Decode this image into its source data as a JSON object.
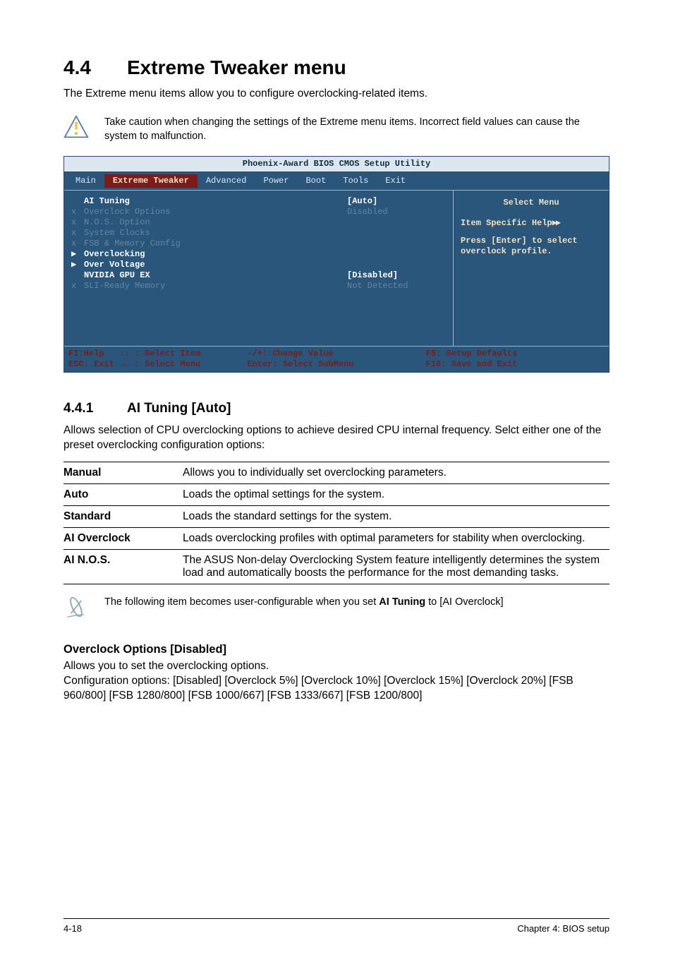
{
  "heading": {
    "num": "4.4",
    "title": "Extreme Tweaker menu"
  },
  "intro": "The Extreme menu items allow you to configure overclocking-related items.",
  "warn": "Take caution when changing the settings of the Extreme menu items. Incorrect field values can cause the system to malfunction.",
  "bios": {
    "title": "Phoenix-Award BIOS CMOS Setup Utility",
    "menu": [
      "Main",
      "Extreme Tweaker",
      "Advanced",
      "Power",
      "Boot",
      "Tools",
      "Exit"
    ],
    "rows": [
      {
        "marker": "",
        "label": "AI Tuning",
        "value": "[Auto]",
        "bright": true
      },
      {
        "marker": "x",
        "label": "Overclock Options",
        "value": "Disabled",
        "dim": true
      },
      {
        "marker": "x",
        "label": "N.O.S. Option",
        "value": "",
        "dim": true
      },
      {
        "marker": "x",
        "label": "System Clocks",
        "value": "",
        "dim": true
      },
      {
        "marker": "x",
        "label": "FSB & Memory Config",
        "value": "",
        "dim": true
      },
      {
        "marker": "▶",
        "label": "Overclocking",
        "value": "",
        "bright": true
      },
      {
        "marker": "▶",
        "label": "Over Voltage",
        "value": "",
        "bright": true
      },
      {
        "marker": "",
        "label": "NVIDIA GPU EX",
        "value": "[Disabled]",
        "bright": true
      },
      {
        "marker": "",
        "label": "",
        "value": ""
      },
      {
        "marker": "x",
        "label": "SLI-Ready Memory",
        "value": "Not Detected",
        "dim": true
      }
    ],
    "help_title": "Select Menu",
    "help_item": "Item Specific Help",
    "help_body1": "Press [Enter] to select",
    "help_body2": "overclock profile.",
    "foot": {
      "l1a": "F1:Help",
      "l1b": "↑↓ : Select Item",
      "l2a": "ESC: Exit",
      "l2b": "→← : Select Menu",
      "c1": "-/+: Change Value",
      "c2": "Enter: Select SubMenu",
      "r1": "F5: Setup Defaults",
      "r2": "F10: Save and Exit"
    }
  },
  "sub": {
    "num": "4.4.1",
    "title": "AI Tuning [Auto]"
  },
  "sub_para": "Allows selection of CPU overclocking options to achieve desired CPU internal frequency. Selct either one of the preset overclocking configuration options:",
  "table": [
    {
      "k": "Manual",
      "v": "Allows you to individually set overclocking parameters."
    },
    {
      "k": "Auto",
      "v": "Loads the optimal settings for the system."
    },
    {
      "k": "Standard",
      "v": "Loads the standard settings for the system."
    },
    {
      "k": "AI Overclock",
      "v": "Loads overclocking profiles with optimal parameters for stability when overclocking."
    },
    {
      "k": "AI N.O.S.",
      "v": "The ASUS Non-delay Overclocking System feature intelligently determines the system load and automatically boosts the performance for the most demanding tasks."
    }
  ],
  "note_pre": "The following item becomes user-configurable when you set ",
  "note_bold": "AI Tuning",
  "note_post": " to [AI Overclock]",
  "sect2_title": "Overclock Options [Disabled]",
  "sect2_line1": "Allows you to set the overclocking options.",
  "sect2_line2": "Configuration options: [Disabled] [Overclock 5%] [Overclock 10%] [Overclock 15%] [Overclock 20%] [FSB 960/800] [FSB 1280/800] [FSB 1000/667] [FSB 1333/667] [FSB 1200/800]",
  "footer": {
    "page": "4-18",
    "chap": "Chapter 4: BIOS setup"
  }
}
